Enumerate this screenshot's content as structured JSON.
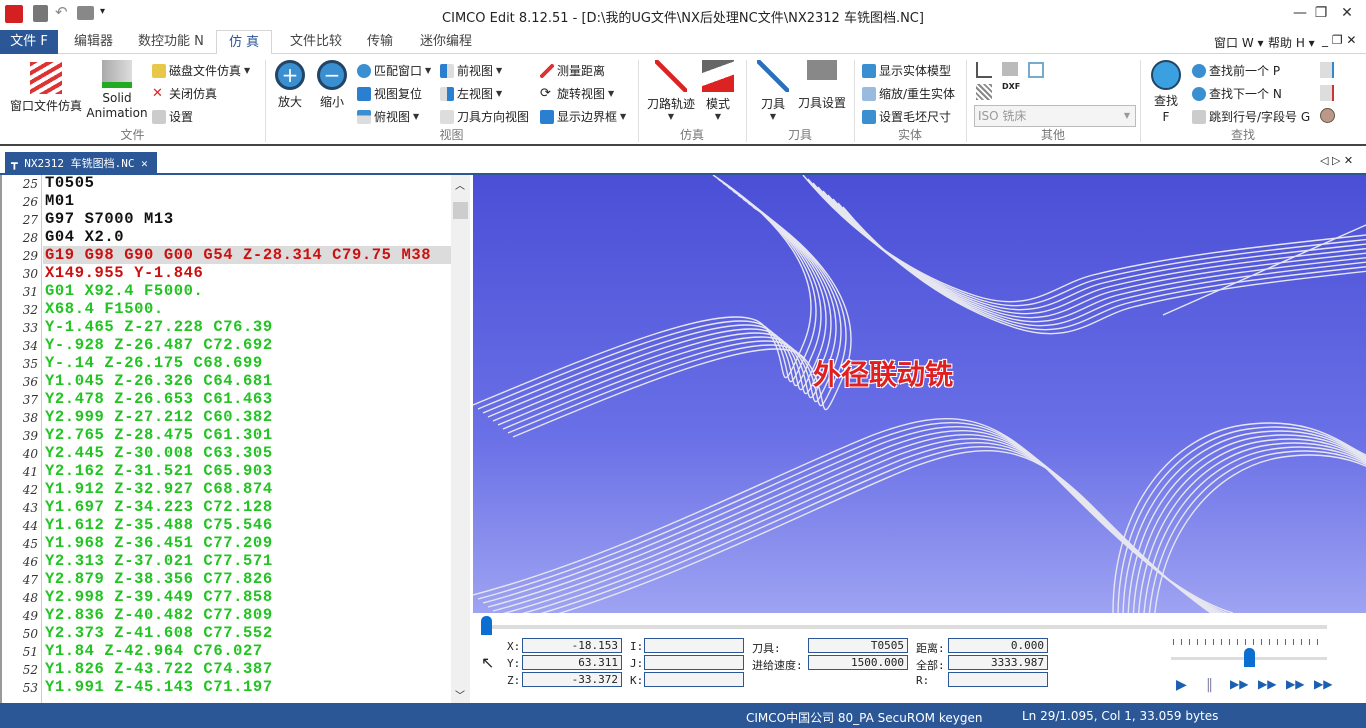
{
  "title": "CIMCO Edit 8.12.51 - [D:\\我的UG文件\\NX后处理NC文件\\NX2312 车铣图档.NC]",
  "menu": {
    "file": "文件 F",
    "tabs": [
      "编辑器",
      "数控功能 N",
      "仿 真",
      "文件比较",
      "传输",
      "迷你编程"
    ],
    "active": 2,
    "right": [
      "窗口 W",
      "帮助 H"
    ]
  },
  "ribbon": {
    "file": {
      "label": "文件",
      "window_sim": "窗口文件仿真",
      "solid1": "Solid",
      "solid2": "Animation",
      "disk_sim": "磁盘文件仿真",
      "close_sim": "关闭仿真",
      "settings": "设置"
    },
    "view": {
      "label": "视图",
      "zoom_in": "放大",
      "zoom_out": "缩小",
      "fit": "匹配窗口",
      "reset": "视图复位",
      "top": "俯视图",
      "front": "前视图",
      "left": "左视图",
      "tool_dir": "刀具方向视图",
      "measure": "测量距离",
      "rotate": "旋转视图",
      "bbox": "显示边界框"
    },
    "sim": {
      "label": "仿真",
      "toolpath": "刀路轨迹",
      "mode": "模式"
    },
    "tool": {
      "label": "刀具",
      "tool": "刀具",
      "tool_settings": "刀具设置"
    },
    "solid": {
      "label": "实体",
      "show": "显示实体模型",
      "zoom_regen": "缩放/重生实体",
      "stock": "设置毛坯尺寸"
    },
    "other": {
      "label": "其他",
      "machine": "ISO 铣床"
    },
    "find": {
      "label": "查找",
      "find1": "查找",
      "find2": "F",
      "prev": "查找前一个 P",
      "next": "查找下一个 N",
      "goto": "跳到行号/字段号 G"
    }
  },
  "doc_tab": "NX2312 车铣图档.NC",
  "editor": {
    "lines": [
      {
        "n": "25",
        "t": "T0505",
        "c": "#111111"
      },
      {
        "n": "26",
        "t": "M01",
        "c": "#111111"
      },
      {
        "n": "27",
        "t": "G97 S7000 M13",
        "c": "#111111"
      },
      {
        "n": "28",
        "t": "G04 X2.0",
        "c": "#111111"
      },
      {
        "n": "29",
        "t": "G19 G98 G90 G00 G54 Z-28.314 C79.75 M38",
        "c": "#cc1010"
      },
      {
        "n": "30",
        "t": "X149.955 Y-1.846",
        "c": "#cc1010"
      },
      {
        "n": "31",
        "t": "G01 X92.4 F5000.",
        "c": "#22c422"
      },
      {
        "n": "32",
        "t": "X68.4 F1500.",
        "c": "#22c422"
      },
      {
        "n": "33",
        "t": "Y-1.465 Z-27.228 C76.39",
        "c": "#22c422"
      },
      {
        "n": "34",
        "t": "Y-.928 Z-26.487 C72.692",
        "c": "#22c422"
      },
      {
        "n": "35",
        "t": "Y-.14 Z-26.175 C68.699",
        "c": "#22c422"
      },
      {
        "n": "36",
        "t": "Y1.045 Z-26.326 C64.681",
        "c": "#22c422"
      },
      {
        "n": "37",
        "t": "Y2.478 Z-26.653 C61.463",
        "c": "#22c422"
      },
      {
        "n": "38",
        "t": "Y2.999 Z-27.212 C60.382",
        "c": "#22c422"
      },
      {
        "n": "39",
        "t": "Y2.765 Z-28.475 C61.301",
        "c": "#22c422"
      },
      {
        "n": "40",
        "t": "Y2.445 Z-30.008 C63.305",
        "c": "#22c422"
      },
      {
        "n": "41",
        "t": "Y2.162 Z-31.521 C65.903",
        "c": "#22c422"
      },
      {
        "n": "42",
        "t": "Y1.912 Z-32.927 C68.874",
        "c": "#22c422"
      },
      {
        "n": "43",
        "t": "Y1.697 Z-34.223 C72.128",
        "c": "#22c422"
      },
      {
        "n": "44",
        "t": "Y1.612 Z-35.488 C75.546",
        "c": "#22c422"
      },
      {
        "n": "45",
        "t": "Y1.968 Z-36.451 C77.209",
        "c": "#22c422"
      },
      {
        "n": "46",
        "t": "Y2.313 Z-37.021 C77.571",
        "c": "#22c422"
      },
      {
        "n": "47",
        "t": "Y2.879 Z-38.356 C77.826",
        "c": "#22c422"
      },
      {
        "n": "48",
        "t": "Y2.998 Z-39.449 C77.858",
        "c": "#22c422"
      },
      {
        "n": "49",
        "t": "Y2.836 Z-40.482 C77.809",
        "c": "#22c422"
      },
      {
        "n": "50",
        "t": "Y2.373 Z-41.608 C77.552",
        "c": "#22c422"
      },
      {
        "n": "51",
        "t": "Y1.84 Z-42.964 C76.027",
        "c": "#22c422"
      },
      {
        "n": "52",
        "t": "Y1.826 Z-43.722 C74.387",
        "c": "#22c422"
      },
      {
        "n": "53",
        "t": "Y1.991 Z-45.143 C71.197",
        "c": "#22c422"
      }
    ]
  },
  "viewport": {
    "overlay_text": "外径联动铣"
  },
  "panel": {
    "x_label": "X:",
    "x": "-18.153",
    "y_label": "Y:",
    "y": "63.311",
    "z_label": "Z:",
    "z": "-33.372",
    "i_label": "I:",
    "j_label": "J:",
    "k_label": "K:",
    "tool_label": "刀具:",
    "tool": "T0505",
    "feed_label": "进给速度:",
    "feed": "1500.000",
    "dist_label": "距离:",
    "dist": "0.000",
    "total_label": "全部:",
    "total": "3333.987",
    "r_label": "R:",
    "progress_percent": 0,
    "speed_percent": 50
  },
  "status": {
    "license": "CIMCO中国公司 80_PA SecuROM keygen",
    "position": "Ln 29/1.095, Col 1, 33.059 bytes"
  }
}
